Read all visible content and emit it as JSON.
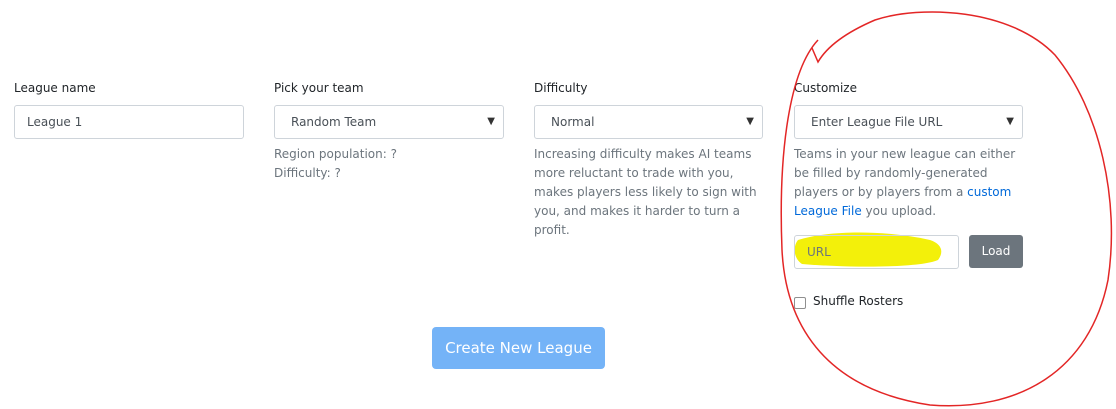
{
  "league_name": {
    "label": "League name",
    "value": "League 1"
  },
  "team": {
    "label": "Pick your team",
    "selected": "Random Team",
    "region_population": "Region population: ?",
    "difficulty": "Difficulty: ?"
  },
  "difficulty": {
    "label": "Difficulty",
    "selected": "Normal",
    "help": "Increasing difficulty makes AI teams more reluctant to trade with you, makes players less likely to sign with you, and makes it harder to turn a profit."
  },
  "customize": {
    "label": "Customize",
    "selected": "Enter League File URL",
    "help_before": "Teams in your new league can either be filled by randomly-generated players or by players from a ",
    "help_link": "custom League File",
    "help_after": " you upload.",
    "url_placeholder": "URL",
    "load_label": "Load",
    "shuffle_label": "Shuffle Rosters"
  },
  "create_label": "Create New League",
  "annotation": {
    "circle_color": "#e32626",
    "highlight_color": "#f3f00a"
  },
  "colors": {
    "primary_button": "#74b3f7",
    "secondary_button": "#6c757d",
    "link": "#0069d9"
  },
  "icons": {
    "select_caret": "caret-down-icon"
  }
}
